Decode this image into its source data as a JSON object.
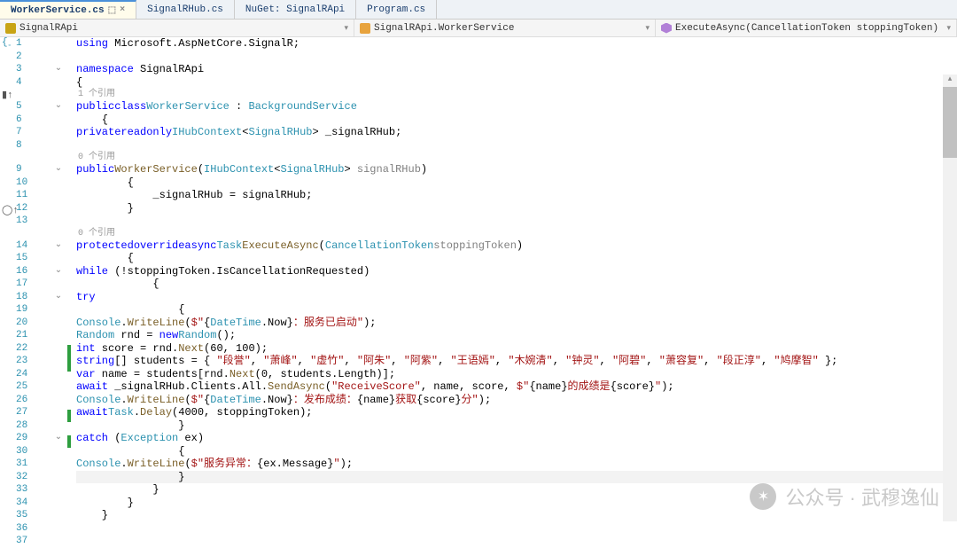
{
  "tabs": [
    {
      "label": "WorkerService.cs",
      "active": true
    },
    {
      "label": "SignalRHub.cs",
      "active": false
    },
    {
      "label": "NuGet: SignalRApi",
      "active": false
    },
    {
      "label": "Program.cs",
      "active": false
    }
  ],
  "nav": {
    "project": "SignalRApi",
    "class": "SignalRApi.WorkerService",
    "member": "ExecuteAsync(CancellationToken stoppingToken)"
  },
  "codelens": {
    "ref1": "1 个引用",
    "ref0a": "0 个引用",
    "ref0b": "0 个引用"
  },
  "code": {
    "l1": {
      "t": "using Microsoft.AspNetCore.SignalR;"
    },
    "l2": {
      "t": ""
    },
    "l3": {
      "t": "namespace SignalRApi"
    },
    "l4": {
      "t": "{"
    },
    "l5": {
      "t": "    public class WorkerService : BackgroundService"
    },
    "l6": {
      "t": "    {"
    },
    "l7": {
      "t": "        private readonly IHubContext<SignalRHub> _signalRHub;"
    },
    "l8": {
      "t": ""
    },
    "l9": {
      "t": "        public WorkerService(IHubContext<SignalRHub> signalRHub)"
    },
    "l10": {
      "t": "        {"
    },
    "l11": {
      "t": "            _signalRHub = signalRHub;"
    },
    "l12": {
      "t": "        }"
    },
    "l13": {
      "t": ""
    },
    "l14": {
      "t": "        protected override async Task ExecuteAsync(CancellationToken stoppingToken)"
    },
    "l15": {
      "t": "        {"
    },
    "l16": {
      "t": "            while (!stoppingToken.IsCancellationRequested)"
    },
    "l17": {
      "t": "            {"
    },
    "l18": {
      "t": "                try"
    },
    "l19": {
      "t": "                {"
    },
    "l20a": "                    Console.WriteLine($\"{DateTime.Now}：服务已启动\");",
    "l21a": "                    Random rnd = new Random();",
    "l22a": "                    int score = rnd.Next(60, 100);",
    "l23a": "                    string[] students = { \"段誉\", \"萧峰\", \"虚竹\", \"阿朱\", \"阿紫\", \"王语嫣\", \"木婉清\", \"钟灵\", \"阿碧\", \"萧容复\", \"段正淳\", \"鸠摩智\" };",
    "l24a": "                    var name = students[rnd.Next(0, students.Length)];",
    "l25a": "                    await _signalRHub.Clients.All.SendAsync(\"ReceiveScore\", name, score, $\"{name}的成绩是{score}\");",
    "l26a": "                    Console.WriteLine($\"{DateTime.Now}：发布成绩：{name}获取{score}分\");",
    "l27a": "                    await Task.Delay(4000, stoppingToken);",
    "l28": {
      "t": "                }"
    },
    "l29a": "                catch (Exception ex)",
    "l30": {
      "t": "                {"
    },
    "l31a": "                    Console.WriteLine($\"服务异常：{ex.Message}\");",
    "l32": {
      "t": "                }"
    },
    "l33": {
      "t": "            }"
    },
    "l34": {
      "t": "        }"
    },
    "l35": {
      "t": "    }"
    },
    "l36": {
      "t": "}"
    },
    "l37": {
      "t": ""
    }
  },
  "watermark": "公众号 · 武穆逸仙"
}
